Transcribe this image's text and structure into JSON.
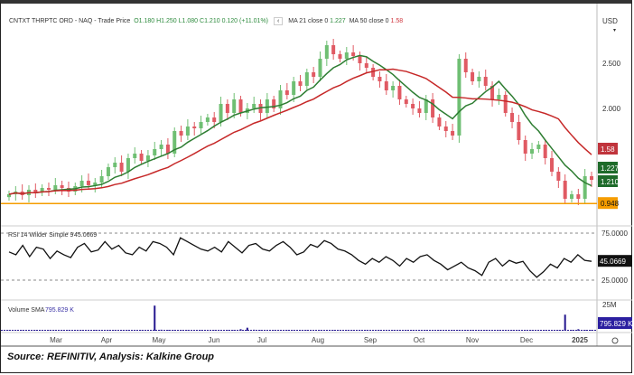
{
  "header": {
    "symbol": "CNTXT THRPTC ORD - NAQ - Trade Price",
    "open": "O1.180",
    "high": "H1.250",
    "low": "L1.080",
    "close": "C1.210",
    "change": "0.120 (+11.01%)",
    "ma21_label": "MA 21 close 0",
    "ma21_value": "1.227",
    "ma50_label": "MA 50 close 0",
    "ma50_value": "1.58",
    "currency": "USD"
  },
  "source": "Source: REFINITIV, Analysis: Kalkine Group",
  "chart_data": [
    {
      "type": "candlestick",
      "title": "CNTXT THRPTC ORD - NAQ - Trade Price",
      "y_ticks": [
        "2.500",
        "2.000"
      ],
      "ylim": [
        0.9,
        2.9
      ],
      "closes": [
        1.05,
        1.08,
        1.04,
        1.1,
        1.07,
        1.12,
        1.1,
        1.15,
        1.12,
        1.08,
        1.14,
        1.2,
        1.15,
        1.18,
        1.25,
        1.35,
        1.4,
        1.3,
        1.45,
        1.5,
        1.42,
        1.48,
        1.55,
        1.6,
        1.5,
        1.75,
        1.7,
        1.8,
        1.78,
        1.85,
        1.9,
        1.85,
        2.05,
        1.95,
        2.1,
        1.95,
        2.0,
        2.05,
        1.95,
        2.1,
        2.0,
        2.2,
        2.15,
        2.3,
        2.25,
        2.4,
        2.35,
        2.55,
        2.7,
        2.6,
        2.55,
        2.62,
        2.58,
        2.5,
        2.45,
        2.35,
        2.3,
        2.2,
        2.25,
        2.1,
        2.05,
        2.0,
        1.95,
        2.1,
        1.9,
        1.8,
        1.75,
        1.7,
        2.55,
        2.4,
        2.3,
        2.35,
        2.25,
        2.1,
        2.15,
        1.95,
        1.85,
        1.65,
        1.5,
        1.55,
        1.6,
        1.45,
        1.3,
        1.2,
        1.0,
        1.05,
        1.0,
        1.25,
        1.21
      ],
      "series": [
        {
          "name": "MA 21",
          "color": "#2e7d32",
          "last": "1.227"
        },
        {
          "name": "MA 50",
          "color": "#c62828",
          "last": "1.58"
        }
      ],
      "horizontal_line": {
        "value": 0.948,
        "label": "0.948",
        "color": "#f59c00"
      },
      "price_tags": [
        "1.58",
        "1.227",
        "1.210"
      ],
      "x_ticks": [
        "Mar",
        "Apr",
        "May",
        "Jun",
        "Jul",
        "Aug",
        "Sep",
        "Oct",
        "Nov",
        "Dec",
        "2025"
      ]
    },
    {
      "type": "line",
      "title": "RSI 14 Wilder Simple 9",
      "value_label": "45.0669",
      "y_ticks": [
        "75.0000",
        "25.0000"
      ],
      "ylim": [
        0,
        100
      ],
      "values": [
        55,
        52,
        62,
        50,
        60,
        58,
        48,
        56,
        52,
        49,
        60,
        64,
        55,
        57,
        66,
        58,
        62,
        54,
        52,
        60,
        56,
        66,
        64,
        60,
        52,
        70,
        66,
        62,
        58,
        56,
        60,
        55,
        66,
        60,
        54,
        62,
        64,
        58,
        56,
        62,
        66,
        60,
        52,
        55,
        63,
        60,
        67,
        64,
        58,
        56,
        52,
        46,
        42,
        48,
        44,
        50,
        46,
        40,
        48,
        44,
        50,
        52,
        46,
        42,
        36,
        40,
        44,
        38,
        35,
        30,
        44,
        48,
        40,
        46,
        43,
        45,
        35,
        28,
        34,
        42,
        38,
        48,
        44,
        52,
        46,
        45
      ]
    },
    {
      "type": "bar",
      "title": "Volume SMA",
      "value_label": "795.829 K",
      "y_ticks": [
        "25M"
      ],
      "values": [
        0.3,
        0.3,
        0.3,
        0.3,
        0.3,
        0.3,
        0.3,
        0.3,
        0.3,
        0.3,
        0.3,
        0.3,
        0.3,
        0.5,
        0.3,
        0.3,
        0.3,
        0.3,
        0.3,
        0.3,
        0.3,
        0.3,
        25,
        1,
        0.7,
        0.4,
        0.5,
        0.4,
        0.3,
        0.4,
        0.3,
        0.4,
        0.3,
        0.5,
        0.6,
        1.5,
        3,
        1,
        0.5,
        0.4,
        0.3,
        0.3,
        0.4,
        0.3,
        0.3,
        0.4,
        0.3,
        0.3,
        0.3,
        0.4,
        0.3,
        0.3,
        0.3,
        0.3,
        0.3,
        0.3,
        0.3,
        0.3,
        0.3,
        0.3,
        0.3,
        0.3,
        0.3,
        0.3,
        0.3,
        0.3,
        0.3,
        0.3,
        0.4,
        0.3,
        0.3,
        0.3,
        0.3,
        0.3,
        0.3,
        0.3,
        0.3,
        0.3,
        0.3,
        0.3,
        0.3,
        0.3,
        0.3,
        0.3,
        16,
        0.5,
        1.5,
        0.8,
        0.6
      ],
      "y_max": 27
    }
  ]
}
